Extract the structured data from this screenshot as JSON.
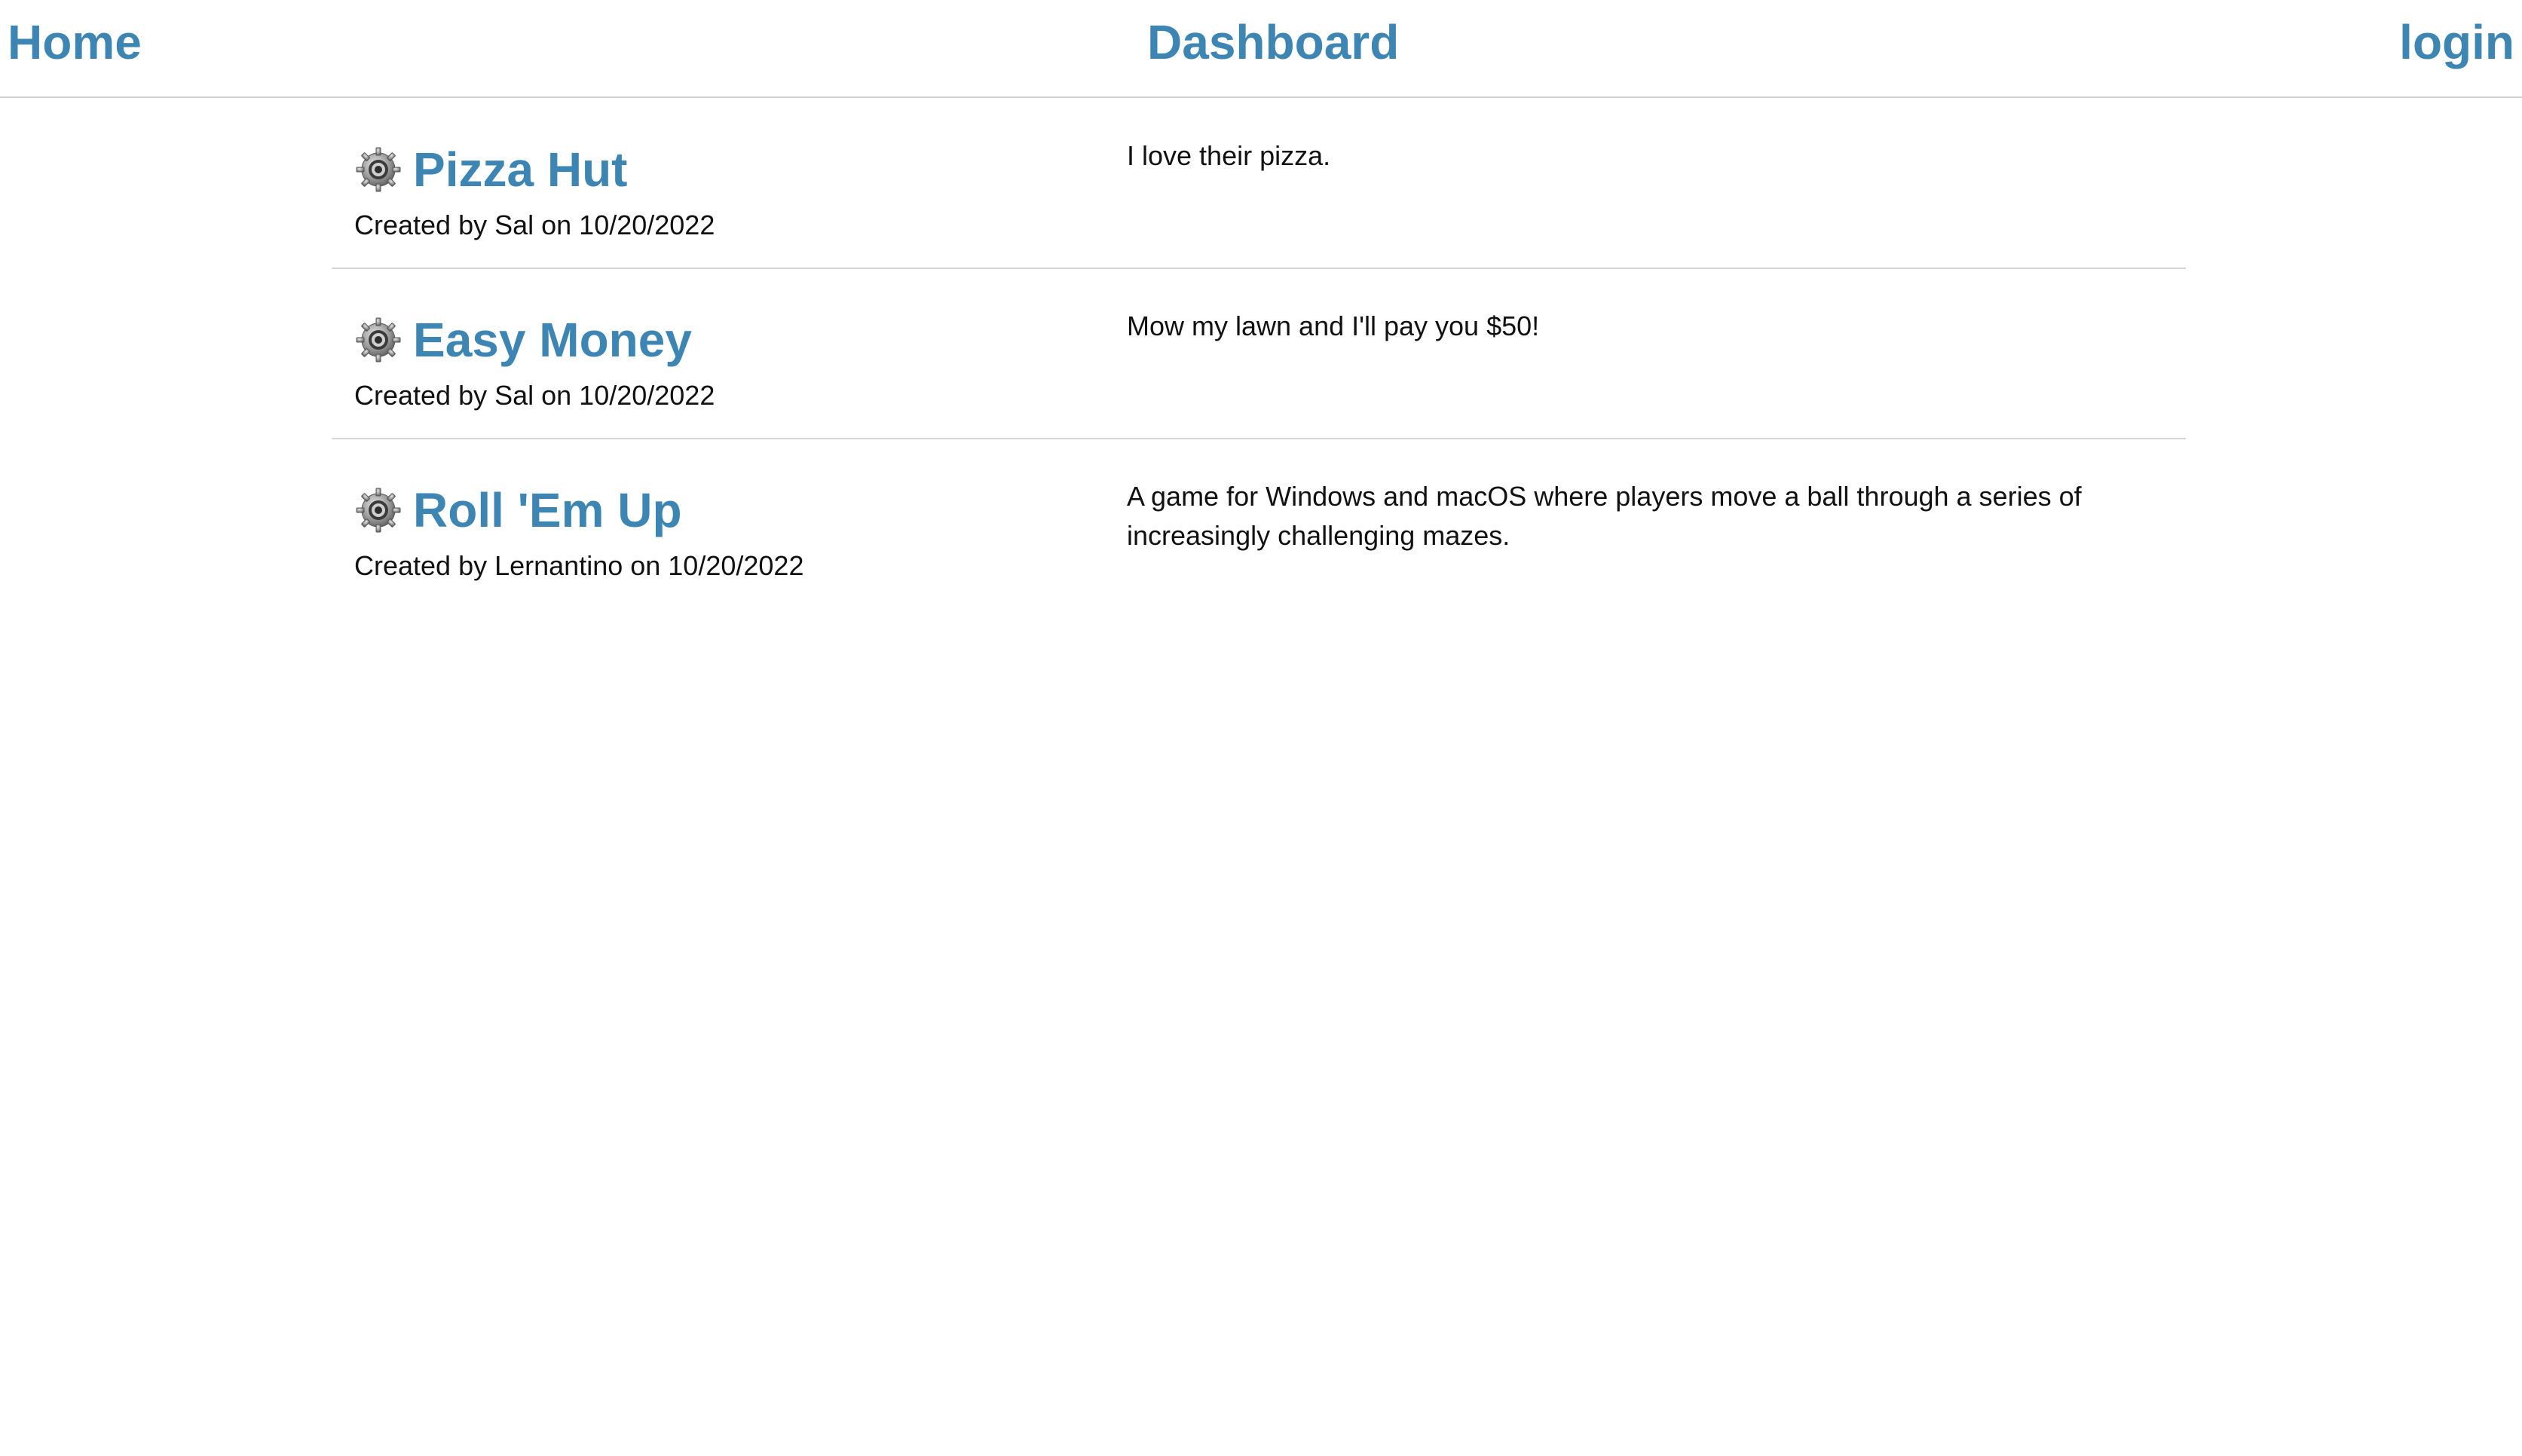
{
  "nav": {
    "home": "Home",
    "dashboard": "Dashboard",
    "login": "login"
  },
  "items": [
    {
      "icon": "gear-icon",
      "title": "Pizza Hut",
      "meta": "Created by Sal on 10/20/2022",
      "description": "I love their pizza."
    },
    {
      "icon": "gear-icon",
      "title": "Easy Money",
      "meta": "Created by Sal on 10/20/2022",
      "description": "Mow my lawn and I'll pay you $50!"
    },
    {
      "icon": "gear-icon",
      "title": "Roll 'Em Up",
      "meta": "Created by Lernantino on 10/20/2022",
      "description": "A game for Windows and macOS where players move a ball through a series of increasingly challenging mazes."
    }
  ],
  "colors": {
    "link": "#3d86b3",
    "text": "#111111",
    "divider": "#d6d6d6"
  }
}
